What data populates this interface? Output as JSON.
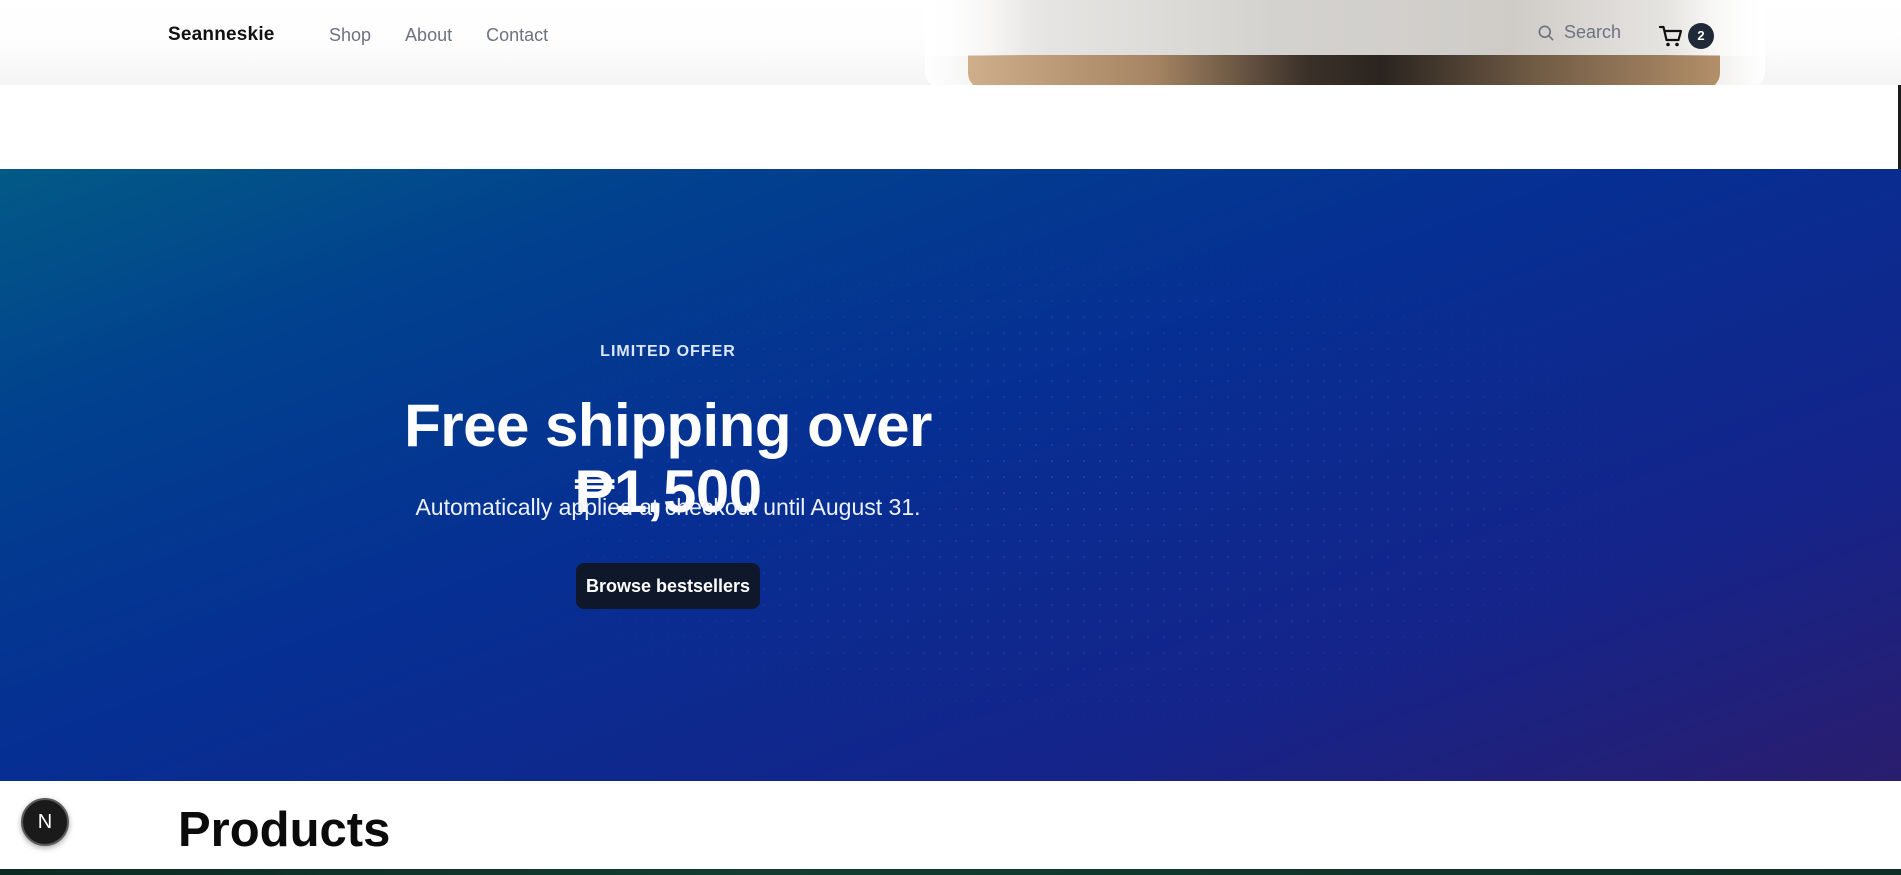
{
  "header": {
    "brand": "Seanneskie",
    "nav": [
      {
        "label": "Shop"
      },
      {
        "label": "About"
      },
      {
        "label": "Contact"
      }
    ],
    "search": {
      "label": "Search",
      "icon": "search-icon"
    },
    "cart": {
      "icon": "cart-icon",
      "count": "2"
    }
  },
  "promo": {
    "eyebrow": "LIMITED OFFER",
    "headline": "Free shipping over ₱1,500",
    "subtext": "Automatically applied at checkout until August 31.",
    "cta_label": "Browse bestsellers",
    "colors": {
      "gradient_start": "#025a86",
      "gradient_mid": "#062f93",
      "gradient_end": "#2a1d6e",
      "cta_background": "#0f172a"
    }
  },
  "products": {
    "title": "Products"
  },
  "floating_button": {
    "label": "N"
  }
}
